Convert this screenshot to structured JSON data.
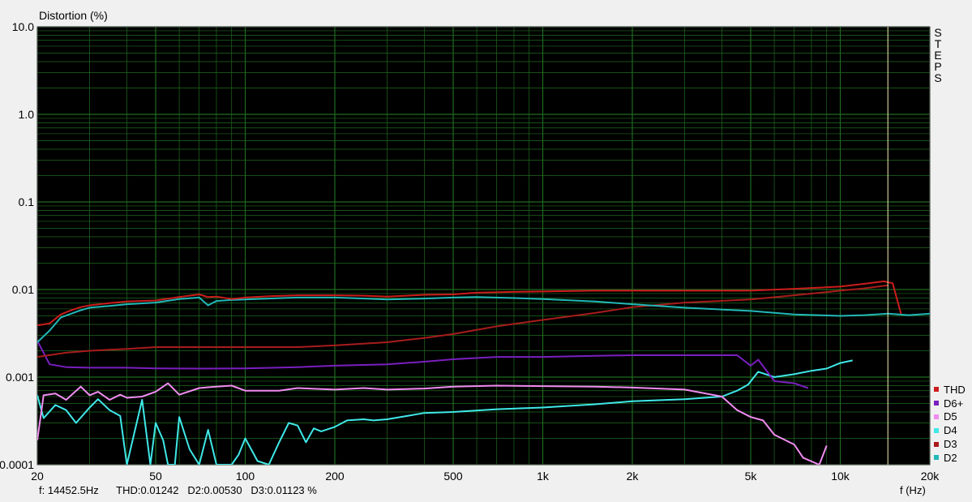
{
  "y_title": "Distortion (%)",
  "steps_letters": [
    "S",
    "T",
    "E",
    "P",
    "S"
  ],
  "readout": {
    "freq": "f: 14452.5Hz",
    "thd": "THD:0.01242",
    "d2": "D2:0.00530",
    "d3": "D3:0.01123 %"
  },
  "x_unit": "f (Hz)",
  "colors": {
    "background": "#000000",
    "grid": "#1f6b1f",
    "cursor": "#f5f0b0",
    "THD": "#cc1c1c",
    "D6+": "#7a1fbf",
    "D5": "#f08cf0",
    "D4": "#40e8e8",
    "D3": "#a81c1c",
    "D2": "#22b8b8"
  },
  "legend": [
    {
      "name": "THD",
      "color": "#cc1c1c"
    },
    {
      "name": "D6+",
      "color": "#7a1fbf"
    },
    {
      "name": "D5",
      "color": "#f08cf0"
    },
    {
      "name": "D4",
      "color": "#40e8e8"
    },
    {
      "name": "D3",
      "color": "#a81c1c"
    },
    {
      "name": "D2",
      "color": "#22b8b8"
    }
  ],
  "chart_data": {
    "type": "line",
    "title": "",
    "xlabel": "f (Hz)",
    "ylabel": "Distortion (%)",
    "x_scale": "log",
    "y_scale": "log",
    "xlim": [
      20,
      20000
    ],
    "ylim": [
      0.0001,
      10
    ],
    "x_ticks": [
      20,
      50,
      100,
      200,
      500,
      1000,
      2000,
      5000,
      10000,
      20000
    ],
    "x_tick_labels": [
      "20",
      "50",
      "100",
      "200",
      "500",
      "1k",
      "2k",
      "5k",
      "10k",
      "20k"
    ],
    "y_ticks": [
      0.0001,
      0.001,
      0.01,
      0.1,
      1,
      10
    ],
    "y_tick_labels": [
      "0.0001",
      "0.001",
      "0.01",
      "0.1",
      "1.0",
      "10.0"
    ],
    "grid": true,
    "legend_position": "bottom-right",
    "cursor_x": 14452.5,
    "series": [
      {
        "name": "THD",
        "x": [
          20,
          22,
          24,
          26,
          28,
          30,
          35,
          40,
          50,
          60,
          70,
          75,
          80,
          90,
          100,
          120,
          150,
          200,
          250,
          300,
          400,
          500,
          600,
          800,
          1000,
          1500,
          2000,
          3000,
          5000,
          7000,
          10000,
          12000,
          14000,
          15000,
          16000
        ],
        "y": [
          0.0039,
          0.0041,
          0.0052,
          0.0058,
          0.0063,
          0.0066,
          0.007,
          0.0073,
          0.0075,
          0.0082,
          0.0088,
          0.0082,
          0.0083,
          0.0078,
          0.0081,
          0.0084,
          0.0086,
          0.0086,
          0.0085,
          0.0083,
          0.0087,
          0.0088,
          0.0092,
          0.0094,
          0.0095,
          0.0097,
          0.0097,
          0.0097,
          0.0097,
          0.0102,
          0.0108,
          0.0116,
          0.0124,
          0.0118,
          0.0053
        ]
      },
      {
        "name": "D2",
        "x": [
          20,
          22,
          24,
          26,
          28,
          30,
          35,
          40,
          50,
          60,
          70,
          75,
          80,
          90,
          100,
          120,
          150,
          200,
          250,
          300,
          400,
          500,
          600,
          800,
          1000,
          1500,
          2000,
          3000,
          5000,
          7000,
          10000,
          12000,
          14500,
          17000,
          20000
        ],
        "y": [
          0.0025,
          0.0034,
          0.0048,
          0.0053,
          0.0058,
          0.0062,
          0.0065,
          0.0068,
          0.0071,
          0.0078,
          0.0081,
          0.0066,
          0.0074,
          0.0076,
          0.0077,
          0.0079,
          0.0081,
          0.0081,
          0.0079,
          0.0077,
          0.0079,
          0.0081,
          0.0082,
          0.008,
          0.0078,
          0.0073,
          0.0068,
          0.0062,
          0.0057,
          0.0052,
          0.005,
          0.0051,
          0.0053,
          0.0051,
          0.0053
        ]
      },
      {
        "name": "D3",
        "x": [
          20,
          25,
          30,
          40,
          50,
          60,
          70,
          100,
          150,
          200,
          300,
          400,
          500,
          700,
          1000,
          1500,
          2000,
          3000,
          5000,
          7000,
          10000,
          12000,
          14500
        ],
        "y": [
          0.0017,
          0.0019,
          0.002,
          0.0021,
          0.0022,
          0.0022,
          0.0022,
          0.0022,
          0.0022,
          0.0023,
          0.0025,
          0.0028,
          0.0031,
          0.0038,
          0.0045,
          0.0054,
          0.0063,
          0.0071,
          0.0077,
          0.0086,
          0.0097,
          0.0103,
          0.0112
        ]
      },
      {
        "name": "D6+",
        "x": [
          20,
          22,
          25,
          30,
          40,
          50,
          70,
          100,
          150,
          200,
          300,
          400,
          500,
          700,
          1000,
          1500,
          2000,
          3000,
          4500,
          5000,
          5300,
          6000,
          7000,
          7800
        ],
        "y": [
          0.0026,
          0.0014,
          0.0013,
          0.00128,
          0.00128,
          0.00126,
          0.00125,
          0.00126,
          0.0013,
          0.00135,
          0.0014,
          0.0015,
          0.0016,
          0.0017,
          0.0017,
          0.00175,
          0.00178,
          0.00178,
          0.00178,
          0.00135,
          0.00158,
          0.0009,
          0.00085,
          0.00075
        ]
      },
      {
        "name": "D5",
        "x": [
          20,
          21,
          23,
          25,
          28,
          30,
          32,
          35,
          38,
          40,
          45,
          50,
          55,
          60,
          70,
          80,
          90,
          100,
          130,
          150,
          200,
          250,
          300,
          400,
          500,
          700,
          1000,
          1500,
          2000,
          3000,
          4000,
          4500,
          5000,
          5500,
          6000,
          7000,
          7500,
          8500,
          9000
        ],
        "y": [
          0.00019,
          0.00062,
          0.00065,
          0.00055,
          0.00078,
          0.00062,
          0.00068,
          0.00055,
          0.00063,
          0.00058,
          0.0006,
          0.00068,
          0.00085,
          0.00063,
          0.00075,
          0.00078,
          0.0008,
          0.0007,
          0.0007,
          0.00075,
          0.00072,
          0.00075,
          0.00072,
          0.00074,
          0.00078,
          0.0008,
          0.00079,
          0.00078,
          0.00076,
          0.00072,
          0.0006,
          0.00042,
          0.00035,
          0.00032,
          0.00022,
          0.00017,
          0.00012,
          0.0001,
          0.000165
        ]
      },
      {
        "name": "D4",
        "x": [
          20,
          21,
          23,
          25,
          27,
          30,
          32,
          35,
          38,
          40,
          45,
          48,
          50,
          53,
          55,
          58,
          60,
          65,
          70,
          75,
          80,
          85,
          90,
          95,
          100,
          110,
          120,
          130,
          140,
          150,
          160,
          170,
          180,
          200,
          220,
          250,
          270,
          300,
          350,
          400,
          500,
          700,
          1000,
          1500,
          2000,
          3000,
          4000,
          4500,
          4900,
          5300,
          6000,
          7000,
          8000,
          9000,
          10000,
          11000
        ],
        "y": [
          0.00062,
          0.00034,
          0.00048,
          0.00042,
          0.0003,
          0.00045,
          0.00056,
          0.00042,
          0.00036,
          0.0001,
          0.00055,
          0.0001,
          0.0003,
          0.00019,
          0.0001,
          0.0001,
          0.00035,
          0.00015,
          0.0001,
          0.00025,
          0.0001,
          0.0001,
          0.0001,
          0.00013,
          0.0002,
          0.00011,
          0.0001,
          0.00018,
          0.0003,
          0.00028,
          0.00018,
          0.00026,
          0.00024,
          0.00027,
          0.00032,
          0.00033,
          0.00032,
          0.00033,
          0.00036,
          0.00039,
          0.0004,
          0.00043,
          0.00045,
          0.00049,
          0.00053,
          0.00056,
          0.0006,
          0.0007,
          0.00082,
          0.00115,
          0.001,
          0.00108,
          0.00118,
          0.00125,
          0.00145,
          0.00155
        ]
      }
    ]
  }
}
